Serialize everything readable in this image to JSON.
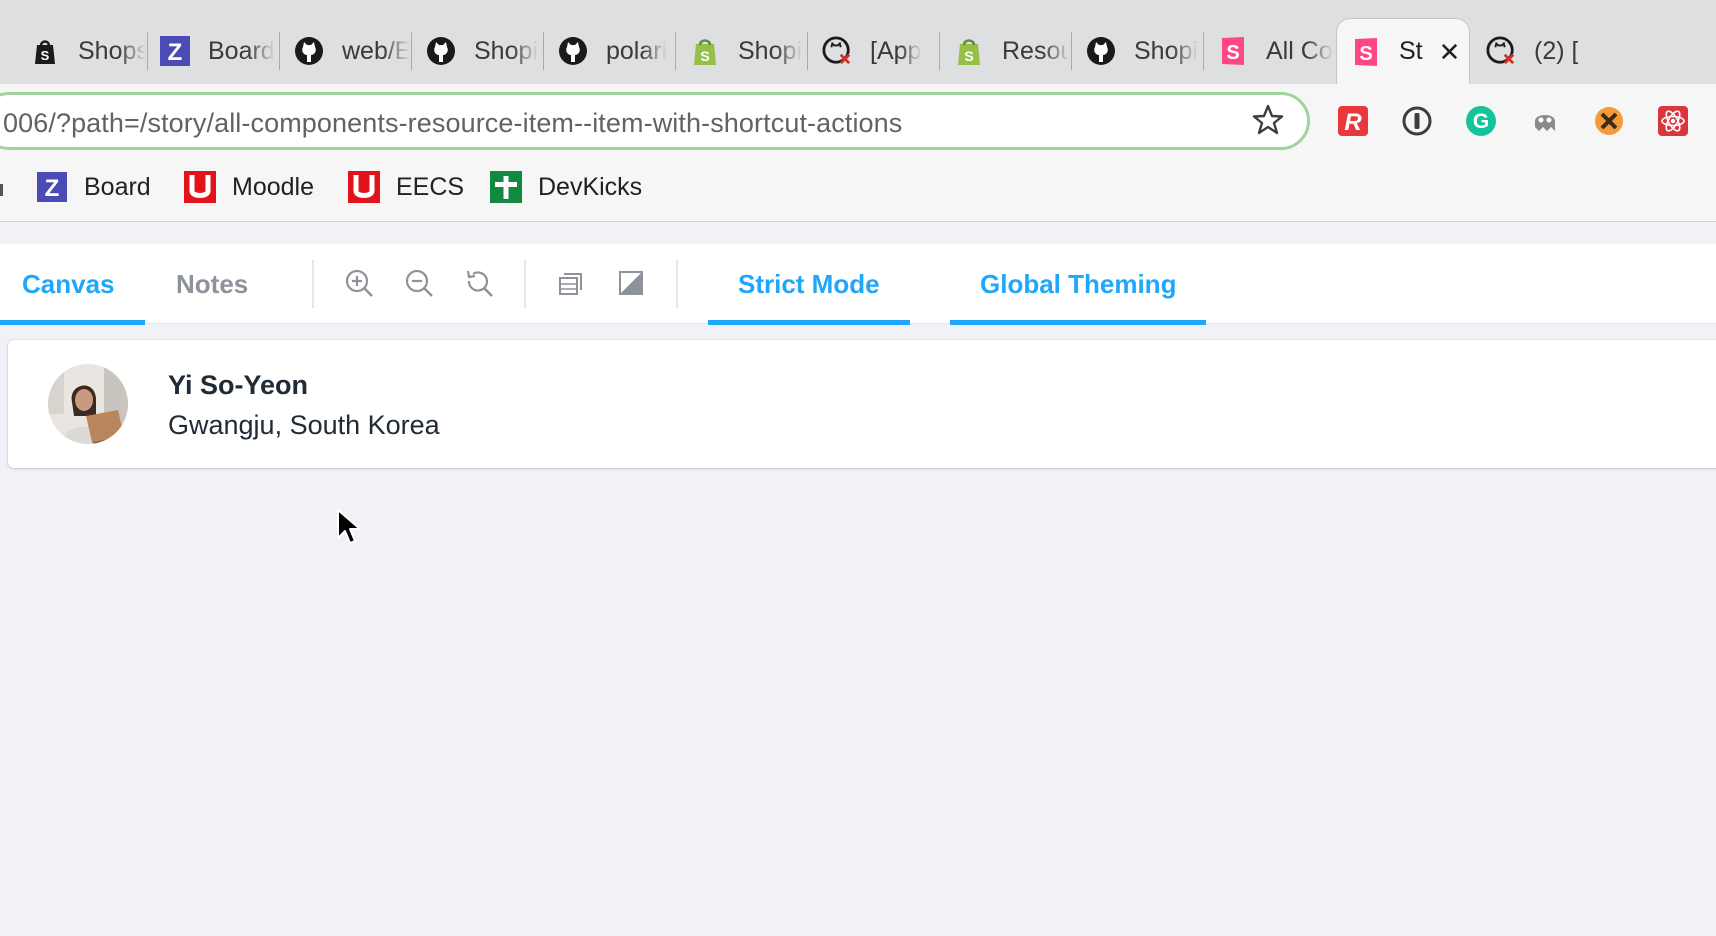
{
  "browser": {
    "tabs": [
      {
        "title": "Shops",
        "icon": "shopify-bag-icon"
      },
      {
        "title": "Board",
        "icon": "zenhub-z-icon"
      },
      {
        "title": "web/E",
        "icon": "github-icon"
      },
      {
        "title": "Shopi",
        "icon": "github-icon"
      },
      {
        "title": "polari",
        "icon": "github-icon"
      },
      {
        "title": "Shopi",
        "icon": "shopify-bag-icon"
      },
      {
        "title": "[App",
        "icon": "github-error-icon"
      },
      {
        "title": "Resou",
        "icon": "shopify-bag-icon"
      },
      {
        "title": "Shopi",
        "icon": "github-icon"
      },
      {
        "title": "All Co",
        "icon": "storybook-icon"
      },
      {
        "title": "St",
        "icon": "storybook-icon",
        "active": true
      },
      {
        "title": "(2) [",
        "icon": "github-error-icon"
      }
    ],
    "close_tab_glyph": "✕",
    "address": {
      "url": "006/?path=/story/all-components-resource-item--item-with-shortcut-actions",
      "star_icon": "bookmark-star-icon"
    },
    "extensions": [
      {
        "name": "r-extension-icon",
        "letter": "R",
        "color": "#e8383d"
      },
      {
        "name": "1password-icon",
        "letter": "1",
        "color": "#3d3d3d"
      },
      {
        "name": "grammarly-icon",
        "letter": "G",
        "color": "#15c39a"
      },
      {
        "name": "octocat-extension-icon",
        "letter": "",
        "color": "#8a8a8a"
      },
      {
        "name": "cross-extension-icon",
        "letter": "",
        "color": "#f29b38"
      },
      {
        "name": "react-devtools-icon",
        "letter": "",
        "color": "#d9363e"
      }
    ],
    "bookmarks": [
      {
        "label": "Board",
        "icon": "zenhub-z-icon"
      },
      {
        "label": "Moodle",
        "icon": "umich-u-icon"
      },
      {
        "label": "EECS",
        "icon": "umich-u-icon"
      },
      {
        "label": "DevKicks",
        "icon": "devkicks-icon"
      }
    ]
  },
  "storybook": {
    "panel_tabs": [
      {
        "label": "Canvas",
        "active": true
      },
      {
        "label": "Notes",
        "active": false
      }
    ],
    "tools": [
      "zoom-in-icon",
      "zoom-out-icon",
      "reset-zoom-icon",
      "background-icon",
      "contrast-icon"
    ],
    "addon_tabs": [
      {
        "label": "Strict Mode",
        "active": true
      },
      {
        "label": "Global Theming",
        "active": true
      }
    ]
  },
  "resource_item": {
    "name": "Yi So-Yeon",
    "location": "Gwangju, South Korea",
    "avatar": "avatar-photo"
  },
  "colors": {
    "accent": "#1ea7fd",
    "omnibox_border": "#a3d39c",
    "text_primary": "#212b36",
    "page_background": "#f1f2f7"
  }
}
